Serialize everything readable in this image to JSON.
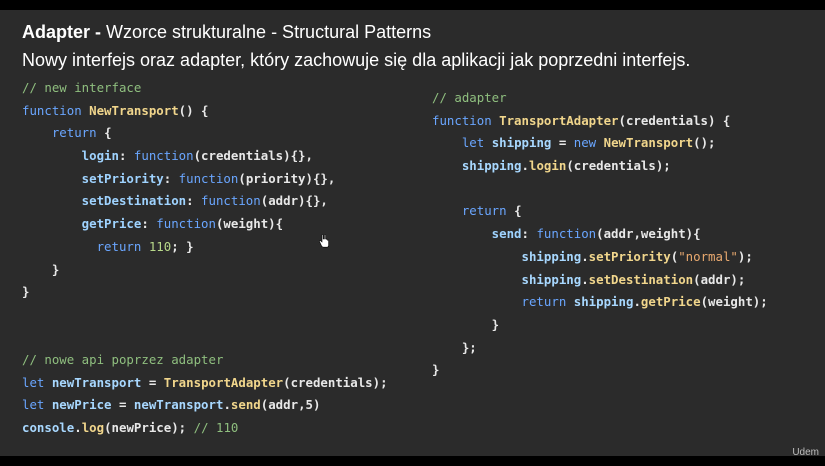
{
  "slide": {
    "title_bold": "Adapter - ",
    "title_rest": "Wzorce strukturalne - Structural Patterns",
    "subtitle": "Nowy interfejs oraz adapter, który zachowuje się dla aplikacji jak poprzedni interfejs.",
    "watermark": "Udem"
  },
  "code_left": [
    {
      "text": "// new interface",
      "type": "comment"
    },
    {
      "parts": [
        {
          "t": "function ",
          "k": "keyword"
        },
        {
          "t": "NewTransport",
          "k": "func"
        },
        {
          "t": "() {",
          "k": "punct"
        }
      ]
    },
    {
      "parts": [
        {
          "t": "    return ",
          "k": "keyword"
        },
        {
          "t": "{",
          "k": "punct"
        }
      ]
    },
    {
      "parts": [
        {
          "t": "        login",
          "k": "prop"
        },
        {
          "t": ": ",
          "k": "punct"
        },
        {
          "t": "function",
          "k": "keyword"
        },
        {
          "t": "(credentials){},",
          "k": "punct"
        }
      ]
    },
    {
      "parts": [
        {
          "t": "        setPriority",
          "k": "prop"
        },
        {
          "t": ": ",
          "k": "punct"
        },
        {
          "t": "function",
          "k": "keyword"
        },
        {
          "t": "(priority){},",
          "k": "punct"
        }
      ]
    },
    {
      "parts": [
        {
          "t": "        setDestination",
          "k": "prop"
        },
        {
          "t": ": ",
          "k": "punct"
        },
        {
          "t": "function",
          "k": "keyword"
        },
        {
          "t": "(addr){},",
          "k": "punct"
        }
      ]
    },
    {
      "parts": [
        {
          "t": "        getPrice",
          "k": "prop"
        },
        {
          "t": ": ",
          "k": "punct"
        },
        {
          "t": "function",
          "k": "keyword"
        },
        {
          "t": "(weight){",
          "k": "punct"
        }
      ]
    },
    {
      "parts": [
        {
          "t": "          return ",
          "k": "keyword"
        },
        {
          "t": "110",
          "k": "num"
        },
        {
          "t": "; }",
          "k": "punct"
        }
      ]
    },
    {
      "parts": [
        {
          "t": "    }",
          "k": "punct"
        }
      ]
    },
    {
      "parts": [
        {
          "t": "}",
          "k": "punct"
        }
      ]
    }
  ],
  "code_right": [
    {
      "text": "// adapter",
      "type": "comment"
    },
    {
      "parts": [
        {
          "t": "function ",
          "k": "keyword"
        },
        {
          "t": "TransportAdapter",
          "k": "func"
        },
        {
          "t": "(credentials) {",
          "k": "punct"
        }
      ]
    },
    {
      "parts": [
        {
          "t": "    let ",
          "k": "keyword"
        },
        {
          "t": "shipping",
          "k": "var"
        },
        {
          "t": " = ",
          "k": "punct"
        },
        {
          "t": "new ",
          "k": "keyword"
        },
        {
          "t": "NewTransport",
          "k": "func"
        },
        {
          "t": "();",
          "k": "punct"
        }
      ]
    },
    {
      "parts": [
        {
          "t": "    shipping",
          "k": "var"
        },
        {
          "t": ".",
          "k": "punct"
        },
        {
          "t": "login",
          "k": "func"
        },
        {
          "t": "(credentials);",
          "k": "punct"
        }
      ]
    },
    {
      "parts": [
        {
          "t": "",
          "k": "punct"
        }
      ]
    },
    {
      "parts": [
        {
          "t": "    return ",
          "k": "keyword"
        },
        {
          "t": "{",
          "k": "punct"
        }
      ]
    },
    {
      "parts": [
        {
          "t": "        send",
          "k": "prop"
        },
        {
          "t": ": ",
          "k": "punct"
        },
        {
          "t": "function",
          "k": "keyword"
        },
        {
          "t": "(addr,weight){",
          "k": "punct"
        }
      ]
    },
    {
      "parts": [
        {
          "t": "            shipping",
          "k": "var"
        },
        {
          "t": ".",
          "k": "punct"
        },
        {
          "t": "setPriority",
          "k": "func"
        },
        {
          "t": "(",
          "k": "punct"
        },
        {
          "t": "\"normal\"",
          "k": "str"
        },
        {
          "t": ");",
          "k": "punct"
        }
      ]
    },
    {
      "parts": [
        {
          "t": "            shipping",
          "k": "var"
        },
        {
          "t": ".",
          "k": "punct"
        },
        {
          "t": "setDestination",
          "k": "func"
        },
        {
          "t": "(addr);",
          "k": "punct"
        }
      ]
    },
    {
      "parts": [
        {
          "t": "            return ",
          "k": "keyword"
        },
        {
          "t": "shipping",
          "k": "var"
        },
        {
          "t": ".",
          "k": "punct"
        },
        {
          "t": "getPrice",
          "k": "func"
        },
        {
          "t": "(weight);",
          "k": "punct"
        }
      ]
    },
    {
      "parts": [
        {
          "t": "        }",
          "k": "punct"
        }
      ]
    },
    {
      "parts": [
        {
          "t": "    };",
          "k": "punct"
        }
      ]
    },
    {
      "parts": [
        {
          "t": "}",
          "k": "punct"
        }
      ]
    }
  ],
  "code_bottom": [
    {
      "text": "// nowe api poprzez adapter",
      "type": "comment"
    },
    {
      "parts": [
        {
          "t": "let ",
          "k": "keyword"
        },
        {
          "t": "newTransport",
          "k": "var"
        },
        {
          "t": " = ",
          "k": "punct"
        },
        {
          "t": "TransportAdapter",
          "k": "func"
        },
        {
          "t": "(credentials);",
          "k": "punct"
        }
      ]
    },
    {
      "parts": [
        {
          "t": "let ",
          "k": "keyword"
        },
        {
          "t": "newPrice",
          "k": "var"
        },
        {
          "t": " = ",
          "k": "punct"
        },
        {
          "t": "newTransport",
          "k": "var"
        },
        {
          "t": ".",
          "k": "punct"
        },
        {
          "t": "send",
          "k": "func"
        },
        {
          "t": "(addr,5)",
          "k": "punct"
        }
      ]
    },
    {
      "parts": [
        {
          "t": "console",
          "k": "var"
        },
        {
          "t": ".",
          "k": "punct"
        },
        {
          "t": "log",
          "k": "func"
        },
        {
          "t": "(newPrice); ",
          "k": "punct"
        },
        {
          "t": "// 110",
          "k": "comment"
        }
      ]
    }
  ],
  "colors": {
    "background": "#2b2b2b",
    "comment": "#8fbf7f",
    "keyword": "#6aa6ff",
    "function": "#f1d68c",
    "string": "#e9a96f"
  },
  "icons": {
    "cursor": "hand-pointer-icon"
  }
}
